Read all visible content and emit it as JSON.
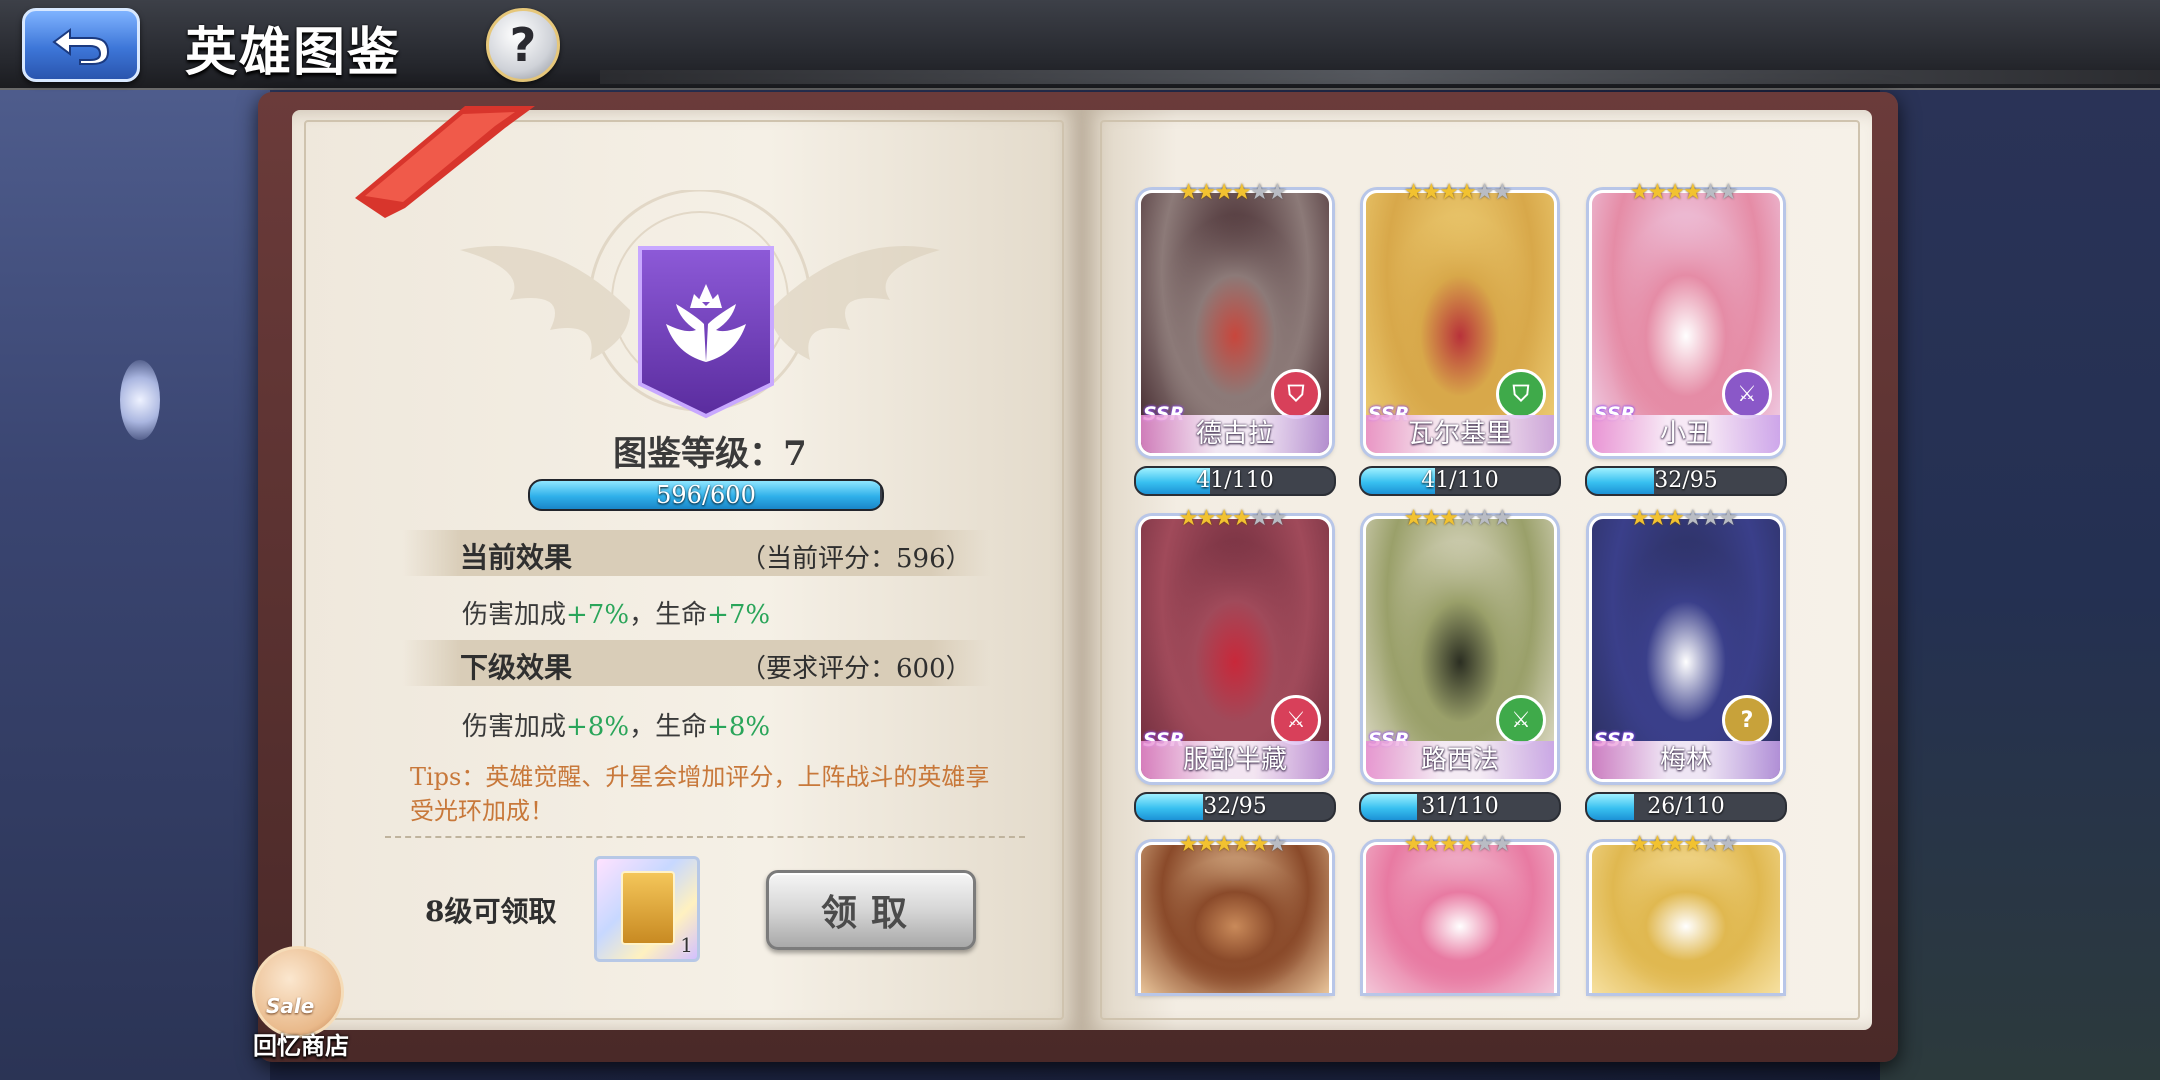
{
  "header": {
    "title": "英雄图鉴",
    "help_label": "?"
  },
  "album": {
    "level_label": "图鉴等级：7",
    "progress_text": "596/600",
    "progress_fraction": 0.993,
    "current": {
      "title": "当前效果",
      "score": "（当前评分：596）",
      "effect_prefix": "伤害加成",
      "effect_damage": "+7%",
      "effect_sep": "，生命",
      "effect_hp": "+7%"
    },
    "next": {
      "title": "下级效果",
      "score": "（要求评分：600）",
      "effect_prefix": "伤害加成",
      "effect_damage": "+8%",
      "effect_sep": "，生命",
      "effect_hp": "+8%"
    },
    "tips": "Tips：英雄觉醒、升星会增加评分，上阵战斗的英雄享受光环加成！",
    "reward_label": "8级可领取",
    "reward_count": "1",
    "claim_label": "领取"
  },
  "shop": {
    "sale_label": "Sale",
    "label": "回忆商店"
  },
  "heroes": [
    {
      "name": "德古拉",
      "rarity": "SSR",
      "stars": 4,
      "progress": "41/110",
      "fraction": 0.373,
      "role_icon": "shield-icon",
      "role_color": "#d8405a",
      "palette": [
        "#3a1e24",
        "#8c7a78",
        "#c8463c"
      ]
    },
    {
      "name": "瓦尔基里",
      "rarity": "SSR",
      "stars": 4,
      "progress": "41/110",
      "fraction": 0.373,
      "role_icon": "shield-icon",
      "role_color": "#3faa4a",
      "palette": [
        "#f0d27a",
        "#d8a84a",
        "#b8323a"
      ]
    },
    {
      "name": "小丑",
      "rarity": "SSR",
      "stars": 4,
      "progress": "32/95",
      "fraction": 0.337,
      "role_icon": "swords-icon",
      "role_color": "#8a58c8",
      "palette": [
        "#f1d6ee",
        "#e58ca6",
        "#ffffff"
      ]
    },
    {
      "name": "服部半藏",
      "rarity": "SSR",
      "stars": 4,
      "progress": "32/95",
      "fraction": 0.337,
      "role_icon": "swords-icon",
      "role_color": "#d8405a",
      "palette": [
        "#6a2a3a",
        "#a04a5a",
        "#c8283a"
      ]
    },
    {
      "name": "路西法",
      "rarity": "SSR",
      "stars": 3,
      "progress": "31/110",
      "fraction": 0.282,
      "role_icon": "swords-icon",
      "role_color": "#3faa4a",
      "palette": [
        "#e6e2d2",
        "#9aa06a",
        "#2b2e22"
      ]
    },
    {
      "name": "梅林",
      "rarity": "SSR",
      "stars": 3,
      "progress": "26/110",
      "fraction": 0.236,
      "role_icon": "question-icon",
      "role_color": "#c8a23a",
      "palette": [
        "#2a2e5a",
        "#3a3f8a",
        "#ffffff"
      ]
    },
    {
      "name": "",
      "rarity": "",
      "stars": 5,
      "progress": "",
      "fraction": 0,
      "role_icon": "",
      "role_color": "",
      "palette": [
        "#e8c49a",
        "#8a4a2a",
        "#c98a5a"
      ]
    },
    {
      "name": "",
      "rarity": "",
      "stars": 4,
      "progress": "",
      "fraction": 0,
      "role_icon": "",
      "role_color": "",
      "palette": [
        "#f3c6d8",
        "#e87aa2",
        "#ffffff"
      ]
    },
    {
      "name": "",
      "rarity": "",
      "stars": 4,
      "progress": "",
      "fraction": 0,
      "role_icon": "",
      "role_color": "",
      "palette": [
        "#f6e0a0",
        "#e0b850",
        "#ffffff"
      ]
    }
  ]
}
